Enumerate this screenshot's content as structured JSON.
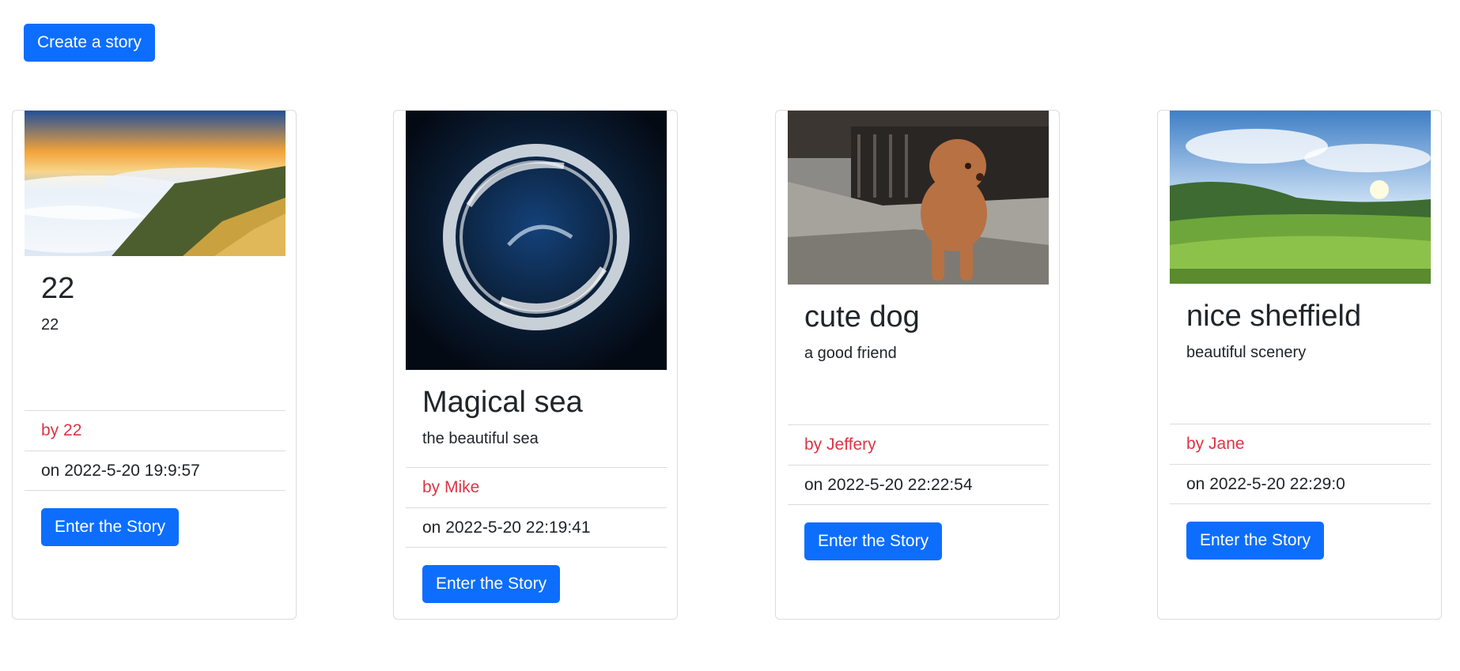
{
  "create_button_label": "Create a story",
  "stories": [
    {
      "title": "22",
      "subtitle": "22",
      "author": "by 22",
      "date": "on 2022-5-20 19:9:57",
      "button": "Enter the Story",
      "image": "mountain-sea-of-clouds"
    },
    {
      "title": "Magical sea",
      "subtitle": "the beautiful sea",
      "author": "by Mike",
      "date": "on 2022-5-20 22:19:41",
      "button": "Enter the Story",
      "image": "swirling-white-circle-on-dark"
    },
    {
      "title": "cute dog",
      "subtitle": "a good friend",
      "author": "by Jeffery",
      "date": "on 2022-5-20 22:22:54",
      "button": "Enter the Story",
      "image": "poodle-on-street"
    },
    {
      "title": "nice sheffield",
      "subtitle": "beautiful scenery",
      "author": "by Jane",
      "date": "on 2022-5-20 22:29:0",
      "button": "Enter the Story",
      "image": "green-field-landscape"
    }
  ],
  "colors": {
    "primary": "#0d6efd",
    "author": "#dc3545"
  }
}
